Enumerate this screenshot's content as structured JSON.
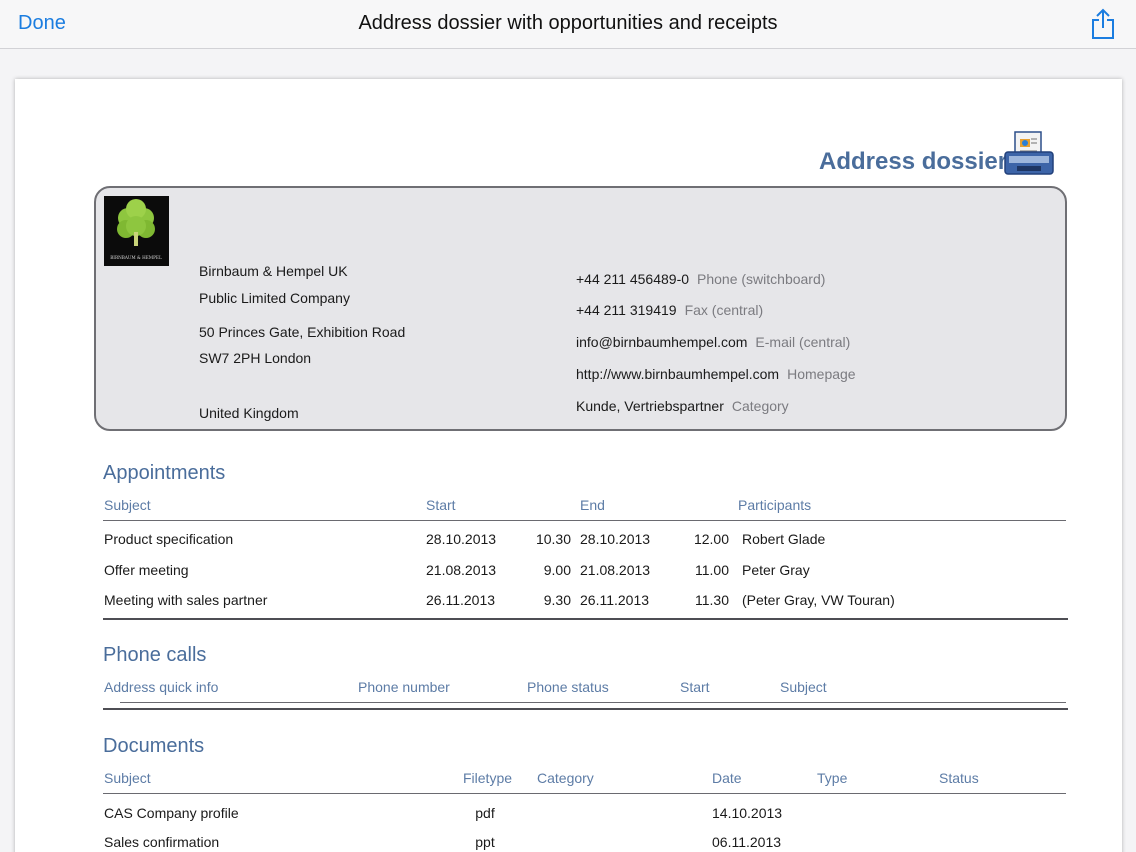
{
  "nav": {
    "done_label": "Done",
    "title": "Address dossier with opportunities and receipts"
  },
  "icons": {
    "share": "share-icon",
    "dossier": "dossier-printer-icon",
    "logo": "tree-logo"
  },
  "colors": {
    "accent": "#1b7de0",
    "heading": "#4a6d9b",
    "card_bg": "#e6e6e9"
  },
  "dossier": {
    "title": "Address dossier",
    "logo_text": "BIRNBAUM & HEMPEL",
    "company_name": "Birnbaum & Hempel UK",
    "company_type": "Public Limited Company",
    "street": "50 Princes Gate, Exhibition Road",
    "city": "SW7 2PH London",
    "country": "United Kingdom",
    "contacts": [
      {
        "value": "+44 211 456489-0",
        "label": "Phone (switchboard)"
      },
      {
        "value": "+44 211 319419",
        "label": "Fax (central)"
      },
      {
        "value": "info@birnbaumhempel.com",
        "label": "E-mail (central)"
      },
      {
        "value": "http://www.birnbaumhempel.com",
        "label": "Homepage"
      },
      {
        "value": "Kunde, Vertriebspartner",
        "label": "Category"
      }
    ]
  },
  "appointments": {
    "title": "Appointments",
    "headers": {
      "subject": "Subject",
      "start": "Start",
      "end": "End",
      "participants": "Participants"
    },
    "rows": [
      {
        "subject": "Product specification",
        "start_date": "28.10.2013",
        "start_time": "10.30",
        "end_date": "28.10.2013",
        "end_time": "12.00",
        "participants": "Robert Glade"
      },
      {
        "subject": "Offer meeting",
        "start_date": "21.08.2013",
        "start_time": "9.00",
        "end_date": "21.08.2013",
        "end_time": "11.00",
        "participants": "Peter Gray"
      },
      {
        "subject": "Meeting with sales partner",
        "start_date": "26.11.2013",
        "start_time": "9.30",
        "end_date": "26.11.2013",
        "end_time": "11.30",
        "participants": "(Peter Gray, VW Touran)"
      }
    ]
  },
  "phone_calls": {
    "title": "Phone calls",
    "headers": {
      "address": "Address quick info",
      "number": "Phone number",
      "status": "Phone status",
      "start": "Start",
      "subject": "Subject"
    }
  },
  "documents": {
    "title": "Documents",
    "headers": {
      "subject": "Subject",
      "filetype": "Filetype",
      "category": "Category",
      "date": "Date",
      "type": "Type",
      "status": "Status"
    },
    "rows": [
      {
        "subject": "CAS Company profile",
        "filetype": "pdf",
        "date": "14.10.2013"
      },
      {
        "subject": "Sales confirmation",
        "filetype": "ppt",
        "date": "06.11.2013"
      }
    ]
  }
}
